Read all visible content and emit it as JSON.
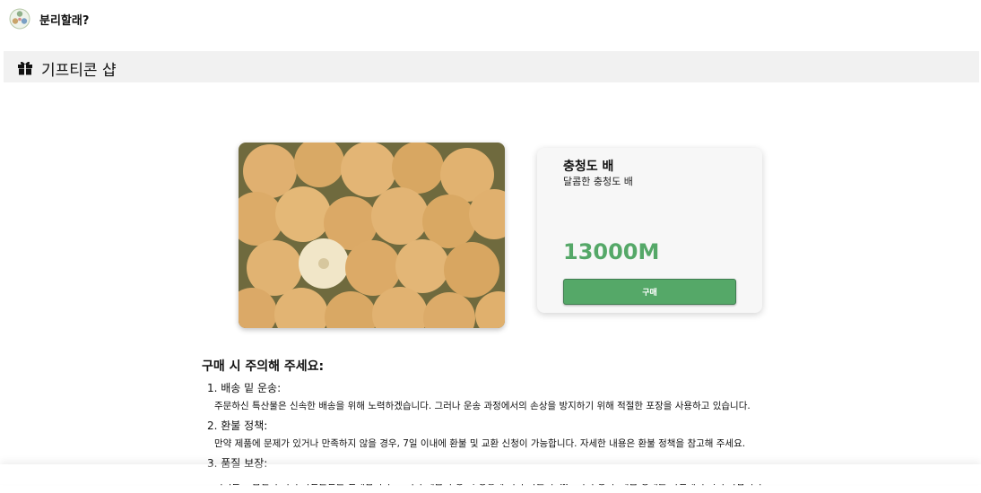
{
  "app": {
    "name": "분리할래?",
    "logo_icon": "recycle-logo-icon"
  },
  "section": {
    "icon": "gift-icon",
    "title": "기프티콘 샵"
  },
  "product": {
    "image_icon": "pear-photo",
    "name": "충청도 배",
    "description": "달콤한 충청도 배",
    "price": "13000M",
    "buy_label": "구매",
    "accent_color": "#55a868"
  },
  "notice": {
    "heading": "구매 시 주의해 주세요:",
    "items": [
      {
        "title": "1. 배송 밑 운송:",
        "text": "주문하신 특산물은 신속한 배송을 위해 노력하겠습니다. 그러나 운송 과정에서의 손상을 방지하기 위해 적절한 포장을 사용하고 있습니다."
      },
      {
        "title": "2. 환불 정책:",
        "text": "만약 제품에 문제가 있거나 만족하지 않을 경우, 7일 이내에 환불 및 교환 신청이 가능합니다. 자세한 내용은 환불 정책을 참고해 주세요."
      },
      {
        "title": "3. 품질 보장:",
        "text": "저희는 고품질의 지역 특산물만을 판매합니다. 그러나 제품 수령 시 상황에 따라 다를 수 있으니 수령 후 제품 상태를 확인해 주시기 바랍니다."
      }
    ]
  }
}
